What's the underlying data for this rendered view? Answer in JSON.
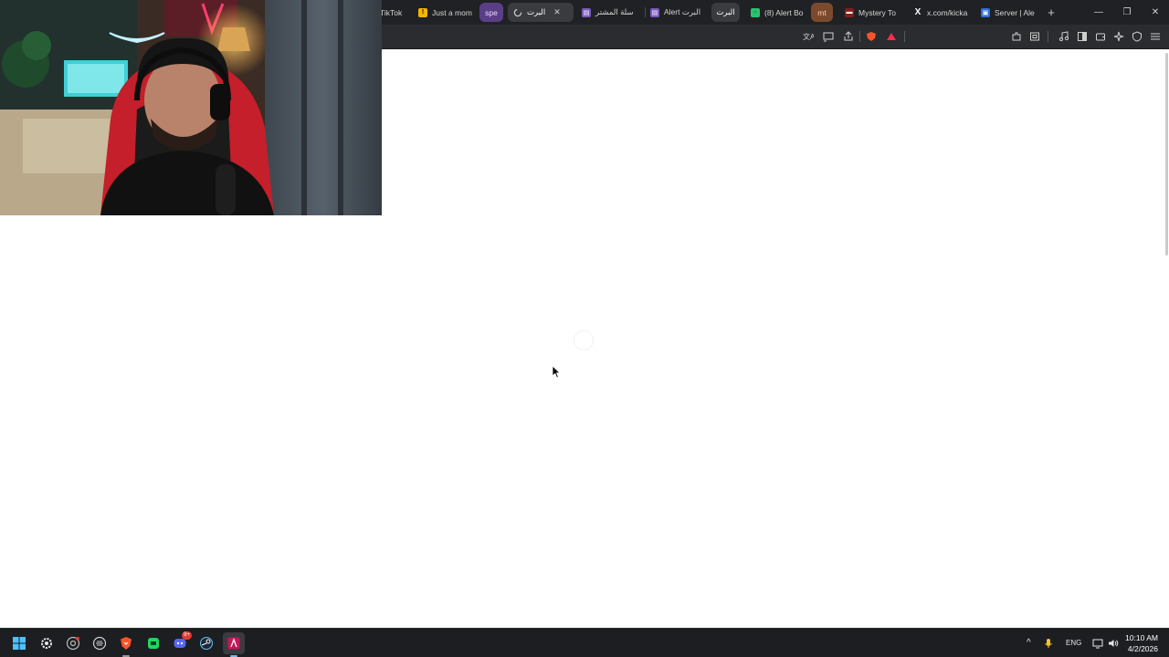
{
  "browser": {
    "tabs": [
      {
        "label": "TikTok",
        "icon": "tiktok-icon"
      },
      {
        "label": "Just a mom",
        "icon": "warning-favicon-icon"
      },
      {
        "label": "spe",
        "icon": ""
      },
      {
        "label": "البرت",
        "icon": "loading-icon",
        "active": true
      },
      {
        "label": "سلة المشتر",
        "icon": "store-icon"
      },
      {
        "label": "Alert البرت",
        "icon": "store-icon"
      },
      {
        "label": "البرت",
        "icon": ""
      },
      {
        "label": "(8) Alert Bo",
        "icon": "chat-icon"
      },
      {
        "label": "mt",
        "icon": ""
      },
      {
        "label": "Mystery To",
        "icon": "mystery-favicon-icon"
      },
      {
        "label": "x.com/kicka",
        "icon": "x-logo-icon"
      },
      {
        "label": "Server | Ale",
        "icon": "server-favicon-icon"
      }
    ],
    "new_tab_symbol": "+",
    "toolbar_icons": [
      "translate-icon",
      "cast-icon",
      "share-icon",
      "brave-shields-icon",
      "brave-rewards-icon",
      "extensions-icon",
      "screenshot-icon",
      "media-icon",
      "sidebar-icon",
      "wallet-icon",
      "leo-ai-icon",
      "vpn-icon",
      "menu-icon"
    ]
  },
  "taskbar": {
    "apps": [
      "windows-start-icon",
      "settings-icon",
      "chrome-icon",
      "lines-icon",
      "brave-icon",
      "app-green-icon",
      "discord-icon",
      "steam-icon",
      "app-red-icon"
    ],
    "discord_badge": "9+",
    "language": "ENG",
    "time": "10:10 AM",
    "date": "4/2/2026"
  }
}
